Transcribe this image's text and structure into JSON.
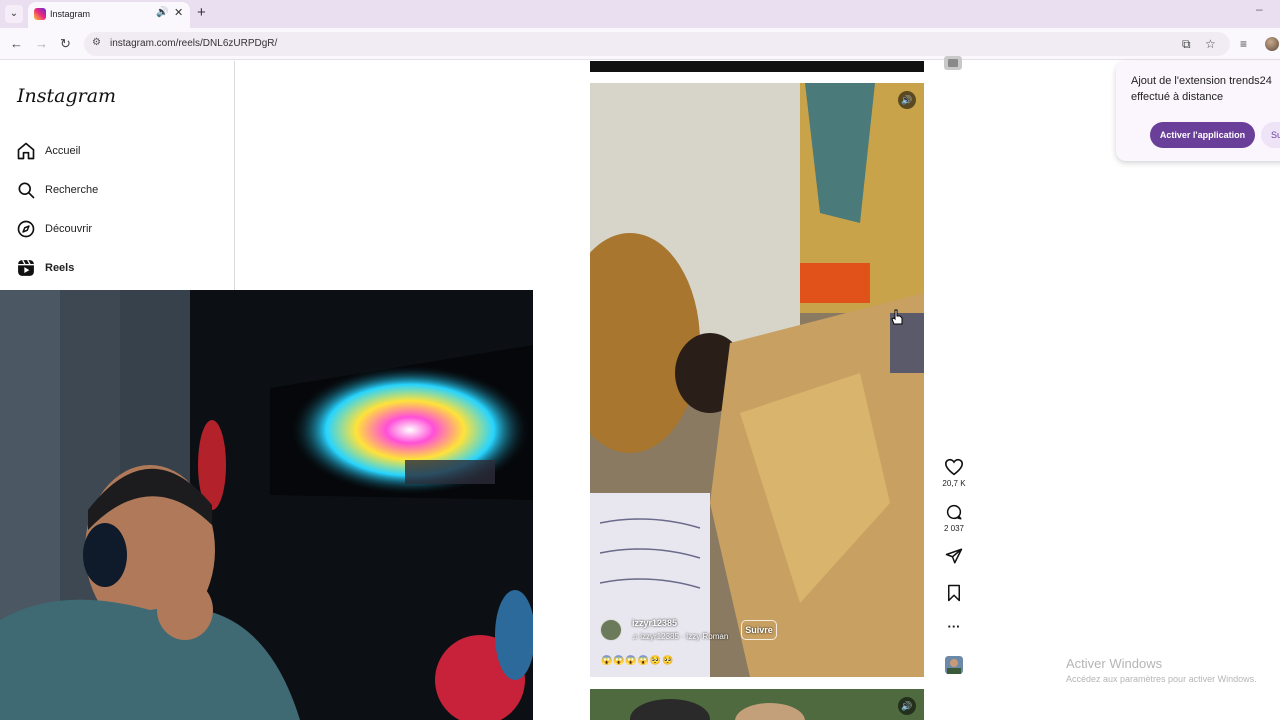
{
  "browser": {
    "tab_title": "Instagram",
    "url": "instagram.com/reels/DNL6zURPDgR/"
  },
  "sidebar": {
    "logo": "Instagram",
    "items": [
      {
        "label": "Accueil",
        "icon": "home-icon"
      },
      {
        "label": "Recherche",
        "icon": "search-icon"
      },
      {
        "label": "Découvrir",
        "icon": "compass-icon"
      },
      {
        "label": "Reels",
        "icon": "reels-icon"
      }
    ]
  },
  "reel": {
    "author": "izzyr12385",
    "audio": "izzyr12385 · Izzy Roman",
    "follow_label": "Suivre",
    "emojis": "😱😱😱😱🥺🥺",
    "likes": "20,7 K",
    "comments": "2 037"
  },
  "extension_popup": {
    "message": "Ajout de l'extension trends24 effectué à distance",
    "primary_button": "Activer l'application",
    "secondary_button": "Su"
  },
  "watermark": {
    "title": "Activer Windows",
    "subtitle": "Accédez aux paramètres pour activer Windows."
  },
  "colors": {
    "accent": "#6a3f9a",
    "tab_strip": "#e9dff0"
  }
}
